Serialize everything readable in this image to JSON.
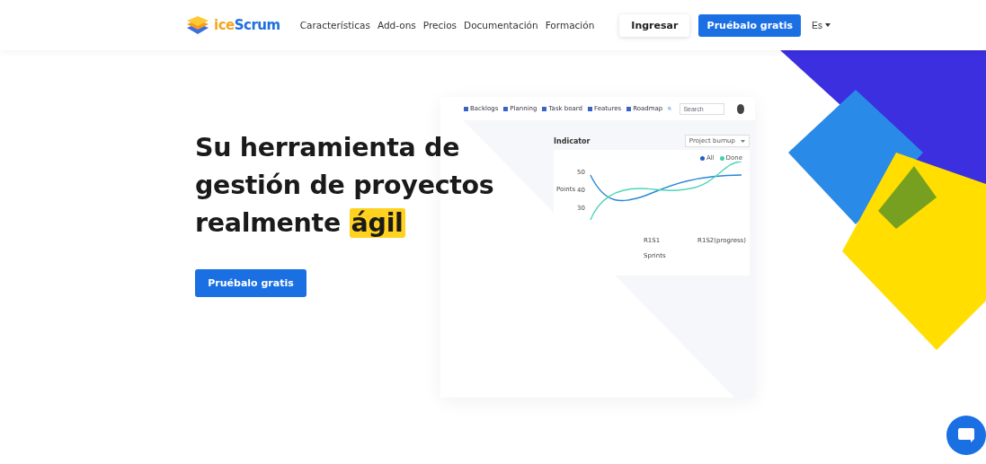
{
  "header": {
    "brand": {
      "prefix": "ice",
      "name": "Scrum"
    },
    "nav": [
      "Características",
      "Add-ons",
      "Precios",
      "Documentación",
      "Formación"
    ],
    "login_button": "Ingresar",
    "trial_button": "Pruébalo gratis",
    "language": "Es"
  },
  "hero": {
    "title_lines": [
      "Su herramienta de",
      "gestión de proyectos",
      "realmente"
    ],
    "highlight": "ágil",
    "cta": "Pruébalo gratis"
  },
  "mockup": {
    "tabs": [
      "Backlogs",
      "Planning",
      "Task board",
      "Features",
      "Roadmap"
    ],
    "search": {
      "placeholder": "Search"
    },
    "indicator": {
      "title": "Indicator",
      "select": "Project burnup",
      "legend": [
        {
          "label": "All",
          "color": "#1f5fc4"
        },
        {
          "label": "Done",
          "color": "#3fd1b0"
        }
      ],
      "yticks": [
        "50",
        "40",
        "30"
      ],
      "ylabel": "Points",
      "xticks": [
        "R1S1",
        "R1S2(progress)"
      ],
      "xlabel": "Sprints"
    }
  }
}
